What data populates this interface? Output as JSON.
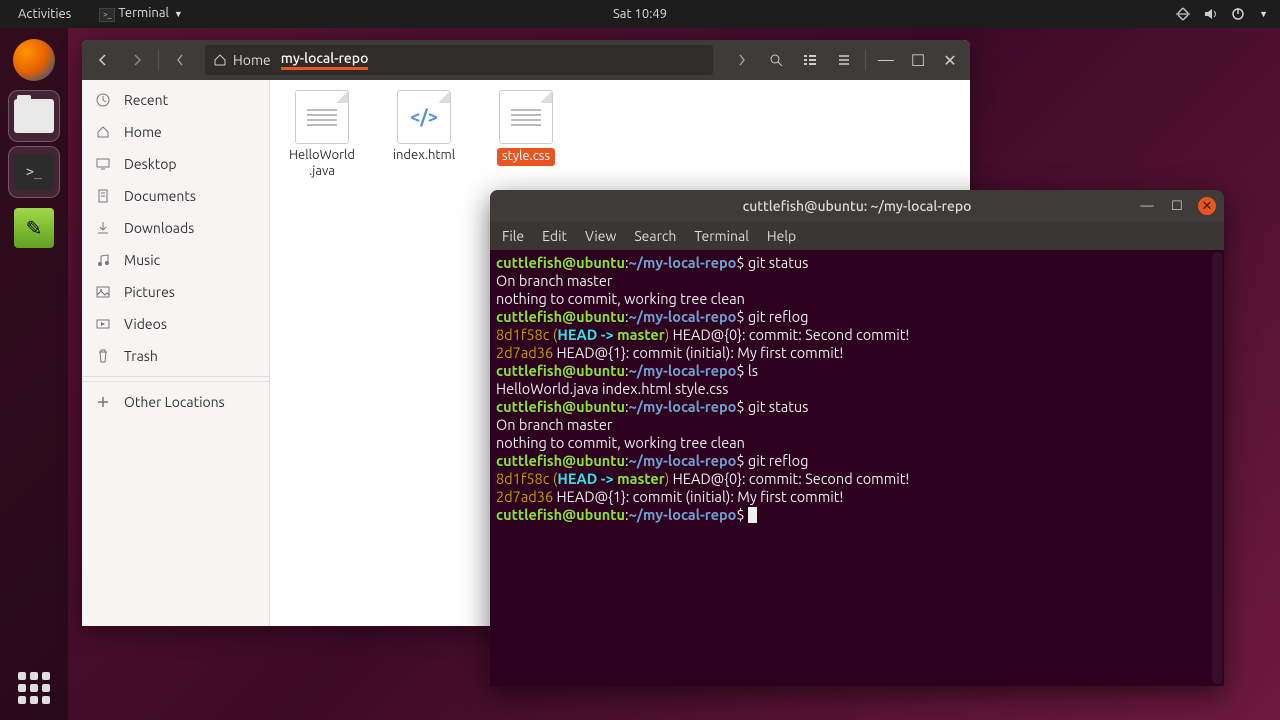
{
  "topbar": {
    "activities": "Activities",
    "app": "Terminal",
    "clock": "Sat 10:49"
  },
  "filewin": {
    "breadcrumb": {
      "home": "Home",
      "current": "my-local-repo"
    },
    "sidebar": [
      {
        "icon": "clock",
        "label": "Recent"
      },
      {
        "icon": "home",
        "label": "Home"
      },
      {
        "icon": "desktop",
        "label": "Desktop"
      },
      {
        "icon": "doc",
        "label": "Documents"
      },
      {
        "icon": "download",
        "label": "Downloads"
      },
      {
        "icon": "music",
        "label": "Music"
      },
      {
        "icon": "pic",
        "label": "Pictures"
      },
      {
        "icon": "video",
        "label": "Videos"
      },
      {
        "icon": "trash",
        "label": "Trash"
      },
      {
        "icon": "plus",
        "label": "Other Locations"
      }
    ],
    "files": [
      {
        "name": "HelloWorld.java",
        "type": "text",
        "selected": false
      },
      {
        "name": "index.html",
        "type": "code",
        "selected": false
      },
      {
        "name": "style.css",
        "type": "text",
        "selected": true
      }
    ]
  },
  "terminal": {
    "title": "cuttlefish@ubuntu: ~/my-local-repo",
    "menu": [
      "File",
      "Edit",
      "View",
      "Search",
      "Terminal",
      "Help"
    ],
    "prompt_user": "cuttlefish@ubuntu",
    "prompt_sep": ":",
    "prompt_path": "~/my-local-repo",
    "prompt_sym": "$",
    "lines": [
      {
        "t": "prompt",
        "cmd": "git status"
      },
      {
        "t": "out",
        "text": "On branch master"
      },
      {
        "t": "out",
        "text": "nothing to commit, working tree clean"
      },
      {
        "t": "prompt",
        "cmd": "git reflog"
      },
      {
        "t": "reflog",
        "hash": "8d1f58c",
        "ref": " (HEAD -> master)",
        "rest": " HEAD@{0}: commit: Second commit!"
      },
      {
        "t": "reflog",
        "hash": "2d7ad36",
        "ref": "",
        "rest": " HEAD@{1}: commit (initial): My first commit!"
      },
      {
        "t": "prompt",
        "cmd": "ls"
      },
      {
        "t": "out",
        "text": "HelloWorld.java  index.html  style.css"
      },
      {
        "t": "prompt",
        "cmd": "git status"
      },
      {
        "t": "out",
        "text": "On branch master"
      },
      {
        "t": "out",
        "text": "nothing to commit, working tree clean"
      },
      {
        "t": "prompt",
        "cmd": "git reflog"
      },
      {
        "t": "reflog",
        "hash": "8d1f58c",
        "ref": " (HEAD -> master)",
        "rest": " HEAD@{0}: commit: Second commit!"
      },
      {
        "t": "reflog",
        "hash": "2d7ad36",
        "ref": "",
        "rest": " HEAD@{1}: commit (initial): My first commit!"
      },
      {
        "t": "prompt",
        "cmd": "",
        "cursor": true
      }
    ]
  }
}
